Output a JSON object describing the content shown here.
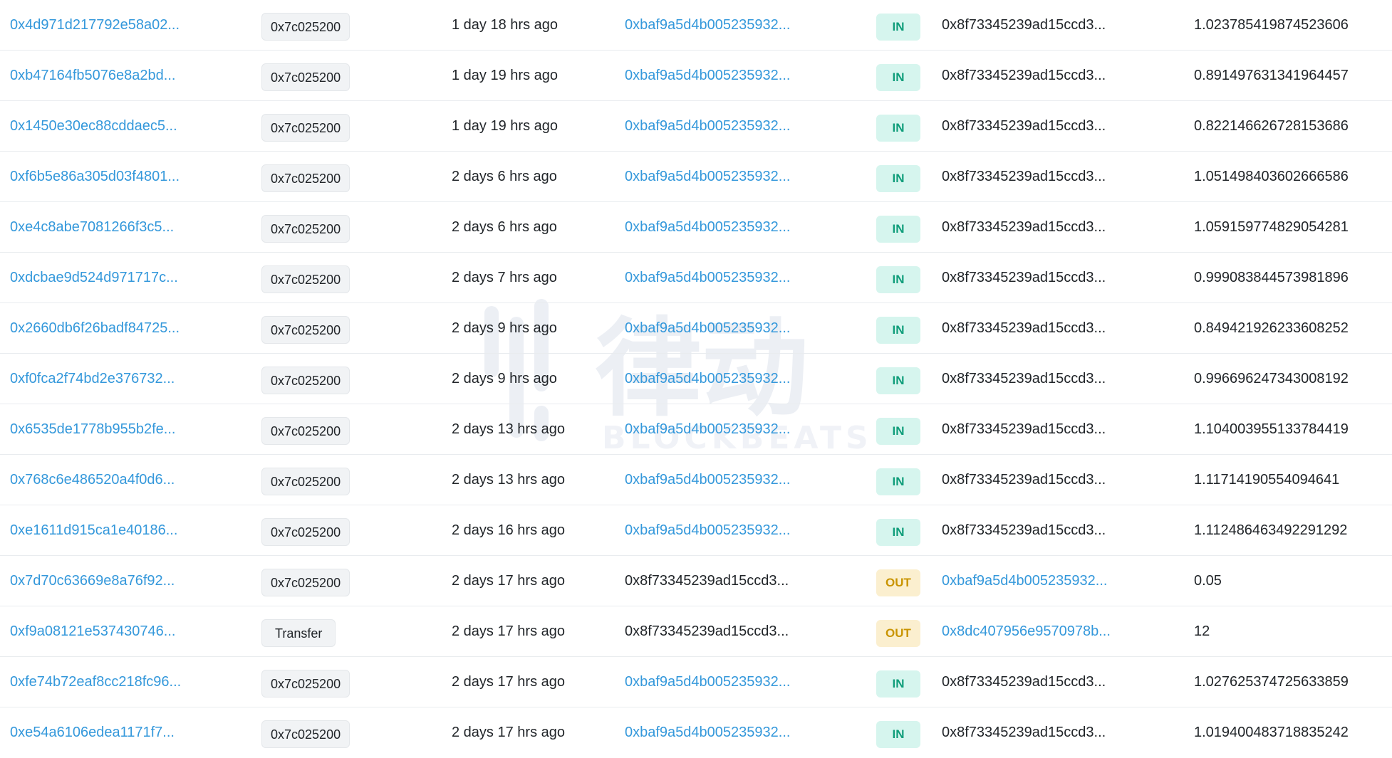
{
  "colors": {
    "link": "#3498db",
    "in_bg": "#d6f5ee",
    "in_text": "#0f9d7a",
    "out_bg": "#fbefcf",
    "out_text": "#c99400",
    "badge_bg": "#f1f3f5",
    "row_border": "#e9ecef"
  },
  "watermark": {
    "cn": "律动",
    "en": "BLOCKBEATS"
  },
  "rows": [
    {
      "hash": "0x4d971d217792e58a02...",
      "method": "0x7c025200",
      "age": "1 day 18 hrs ago",
      "from": "0xbaf9a5d4b005235932...",
      "from_link": true,
      "direction": "IN",
      "to": "0x8f73345239ad15ccd3...",
      "to_link": false,
      "value": "1.023785419874523606"
    },
    {
      "hash": "0xb47164fb5076e8a2bd...",
      "method": "0x7c025200",
      "age": "1 day 19 hrs ago",
      "from": "0xbaf9a5d4b005235932...",
      "from_link": true,
      "direction": "IN",
      "to": "0x8f73345239ad15ccd3...",
      "to_link": false,
      "value": "0.891497631341964457"
    },
    {
      "hash": "0x1450e30ec88cddaec5...",
      "method": "0x7c025200",
      "age": "1 day 19 hrs ago",
      "from": "0xbaf9a5d4b005235932...",
      "from_link": true,
      "direction": "IN",
      "to": "0x8f73345239ad15ccd3...",
      "to_link": false,
      "value": "0.822146626728153686"
    },
    {
      "hash": "0xf6b5e86a305d03f4801...",
      "method": "0x7c025200",
      "age": "2 days 6 hrs ago",
      "from": "0xbaf9a5d4b005235932...",
      "from_link": true,
      "direction": "IN",
      "to": "0x8f73345239ad15ccd3...",
      "to_link": false,
      "value": "1.051498403602666586"
    },
    {
      "hash": "0xe4c8abe7081266f3c5...",
      "method": "0x7c025200",
      "age": "2 days 6 hrs ago",
      "from": "0xbaf9a5d4b005235932...",
      "from_link": true,
      "direction": "IN",
      "to": "0x8f73345239ad15ccd3...",
      "to_link": false,
      "value": "1.059159774829054281"
    },
    {
      "hash": "0xdcbae9d524d971717c...",
      "method": "0x7c025200",
      "age": "2 days 7 hrs ago",
      "from": "0xbaf9a5d4b005235932...",
      "from_link": true,
      "direction": "IN",
      "to": "0x8f73345239ad15ccd3...",
      "to_link": false,
      "value": "0.999083844573981896"
    },
    {
      "hash": "0x2660db6f26badf84725...",
      "method": "0x7c025200",
      "age": "2 days 9 hrs ago",
      "from": "0xbaf9a5d4b005235932...",
      "from_link": true,
      "direction": "IN",
      "to": "0x8f73345239ad15ccd3...",
      "to_link": false,
      "value": "0.849421926233608252"
    },
    {
      "hash": "0xf0fca2f74bd2e376732...",
      "method": "0x7c025200",
      "age": "2 days 9 hrs ago",
      "from": "0xbaf9a5d4b005235932...",
      "from_link": true,
      "direction": "IN",
      "to": "0x8f73345239ad15ccd3...",
      "to_link": false,
      "value": "0.996696247343008192"
    },
    {
      "hash": "0x6535de1778b955b2fe...",
      "method": "0x7c025200",
      "age": "2 days 13 hrs ago",
      "from": "0xbaf9a5d4b005235932...",
      "from_link": true,
      "direction": "IN",
      "to": "0x8f73345239ad15ccd3...",
      "to_link": false,
      "value": "1.104003955133784419"
    },
    {
      "hash": "0x768c6e486520a4f0d6...",
      "method": "0x7c025200",
      "age": "2 days 13 hrs ago",
      "from": "0xbaf9a5d4b005235932...",
      "from_link": true,
      "direction": "IN",
      "to": "0x8f73345239ad15ccd3...",
      "to_link": false,
      "value": "1.11714190554094641"
    },
    {
      "hash": "0xe1611d915ca1e40186...",
      "method": "0x7c025200",
      "age": "2 days 16 hrs ago",
      "from": "0xbaf9a5d4b005235932...",
      "from_link": true,
      "direction": "IN",
      "to": "0x8f73345239ad15ccd3...",
      "to_link": false,
      "value": "1.112486463492291292"
    },
    {
      "hash": "0x7d70c63669e8a76f92...",
      "method": "0x7c025200",
      "age": "2 days 17 hrs ago",
      "from": "0x8f73345239ad15ccd3...",
      "from_link": false,
      "direction": "OUT",
      "to": "0xbaf9a5d4b005235932...",
      "to_link": true,
      "value": "0.05"
    },
    {
      "hash": "0xf9a08121e537430746...",
      "method": "Transfer",
      "age": "2 days 17 hrs ago",
      "from": "0x8f73345239ad15ccd3...",
      "from_link": false,
      "direction": "OUT",
      "to": "0x8dc407956e9570978b...",
      "to_link": true,
      "value": "12"
    },
    {
      "hash": "0xfe74b72eaf8cc218fc96...",
      "method": "0x7c025200",
      "age": "2 days 17 hrs ago",
      "from": "0xbaf9a5d4b005235932...",
      "from_link": true,
      "direction": "IN",
      "to": "0x8f73345239ad15ccd3...",
      "to_link": false,
      "value": "1.027625374725633859"
    },
    {
      "hash": "0xe54a6106edea1171f7...",
      "method": "0x7c025200",
      "age": "2 days 17 hrs ago",
      "from": "0xbaf9a5d4b005235932...",
      "from_link": true,
      "direction": "IN",
      "to": "0x8f73345239ad15ccd3...",
      "to_link": false,
      "value": "1.019400483718835242"
    }
  ]
}
